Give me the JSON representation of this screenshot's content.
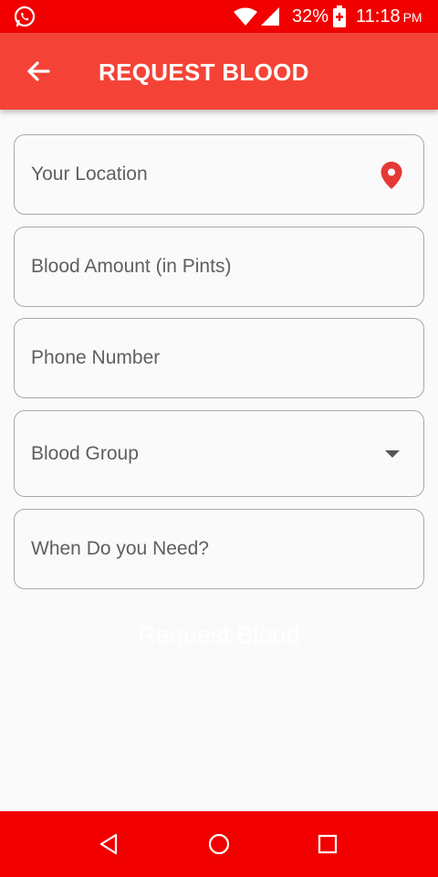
{
  "status_bar": {
    "battery_percent": "32%",
    "time": "11:18",
    "ampm": "PM",
    "icons": [
      "whatsapp-icon",
      "wifi-icon",
      "signal-icon",
      "battery-charging-icon"
    ]
  },
  "app_bar": {
    "title": "REQUEST BLOOD",
    "back_icon": "arrow-back-icon",
    "color": "#f44336"
  },
  "form": {
    "location": {
      "placeholder": "Your Location",
      "icon": "location-pin-icon"
    },
    "blood_amount": {
      "placeholder": "Blood Amount (in Pints)"
    },
    "phone": {
      "placeholder": "Phone Number"
    },
    "blood_group": {
      "placeholder": "Blood Group",
      "icon": "dropdown-arrow-icon"
    },
    "when_needed": {
      "placeholder": "When Do you Need?"
    },
    "submit_label": "Request Blood"
  },
  "nav_bar": {
    "color": "#f20000",
    "icons": [
      "back-triangle-icon",
      "home-circle-icon",
      "recents-square-icon"
    ]
  },
  "colors": {
    "status_bar": "#f20000",
    "accent": "#f44336",
    "pin": "#e53935",
    "background": "#fafafa"
  }
}
